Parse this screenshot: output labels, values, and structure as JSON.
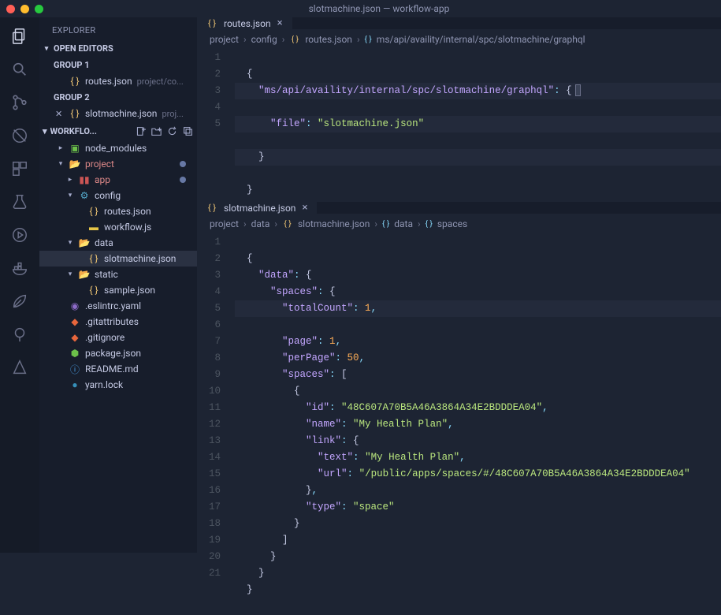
{
  "titlebar": {
    "text": "slotmachine.json — workflow-app"
  },
  "sidebar": {
    "title": "EXPLORER",
    "open_editors": "OPEN EDITORS",
    "group1": "GROUP 1",
    "group2": "GROUP 2",
    "editor1": {
      "name": "routes.json",
      "path": "project/co..."
    },
    "editor2": {
      "name": "slotmachine.json",
      "path": "proj..."
    },
    "workspace_name": "WORKFLO...",
    "tree": {
      "node_modules": "node_modules",
      "project": "project",
      "app": "app",
      "config": "config",
      "routes_json": "routes.json",
      "workflow_js": "workflow.js",
      "data": "data",
      "slotmachine_json": "slotmachine.json",
      "static": "static",
      "sample_json": "sample.json",
      "eslintrc": ".eslintrc.yaml",
      "gitattributes": ".gitattributes",
      "gitignore": ".gitignore",
      "package_json": "package.json",
      "readme": "README.md",
      "yarn_lock": "yarn.lock"
    }
  },
  "pane1": {
    "tab": "routes.json",
    "crumbs": [
      "project",
      "config",
      "routes.json",
      "ms/api/availity/internal/spc/slotmachine/graphql"
    ],
    "line1": "{",
    "line2_key": "\"ms/api/availity/internal/spc/slotmachine/graphql\"",
    "line2_colon": ": ",
    "line2_brace": "{",
    "line3_key": "\"file\"",
    "line3_colon": ": ",
    "line3_val": "\"slotmachine.json\"",
    "line4": "}",
    "line5": "}"
  },
  "pane2": {
    "tab": "slotmachine.json",
    "crumbs": [
      "project",
      "data",
      "slotmachine.json",
      "data",
      "spaces"
    ],
    "lines": {
      "l1": "{",
      "l2_k": "\"data\"",
      "l2_p": ": ",
      "l2_b": "{",
      "l3_k": "\"spaces\"",
      "l3_p": ": ",
      "l3_b": "{",
      "l4_k": "\"totalCount\"",
      "l4_p": ": ",
      "l4_v": "1",
      "l4_c": ",",
      "l5_k": "\"page\"",
      "l5_p": ": ",
      "l5_v": "1",
      "l5_c": ",",
      "l6_k": "\"perPage\"",
      "l6_p": ": ",
      "l6_v": "50",
      "l6_c": ",",
      "l7_k": "\"spaces\"",
      "l7_p": ": ",
      "l7_b": "[",
      "l8": "{",
      "l9_k": "\"id\"",
      "l9_p": ": ",
      "l9_v": "\"48C607A70B5A46A3864A34E2BDDDEA04\"",
      "l9_c": ",",
      "l10_k": "\"name\"",
      "l10_p": ": ",
      "l10_v": "\"My Health Plan\"",
      "l10_c": ",",
      "l11_k": "\"link\"",
      "l11_p": ": ",
      "l11_b": "{",
      "l12_k": "\"text\"",
      "l12_p": ": ",
      "l12_v": "\"My Health Plan\"",
      "l12_c": ",",
      "l13_k": "\"url\"",
      "l13_p": ": ",
      "l13_v": "\"/public/apps/spaces/#/48C607A70B5A46A3864A34E2BDDDEA04\"",
      "l14": "}",
      "l14_c": ",",
      "l15_k": "\"type\"",
      "l15_p": ": ",
      "l15_v": "\"space\"",
      "l16": "}",
      "l17": "]",
      "l18": "}",
      "l19": "}",
      "l20": "}",
      "l21": ""
    }
  },
  "gutters": {
    "p1": [
      "1",
      "2",
      "3",
      "4",
      "5"
    ],
    "p2": [
      "1",
      "2",
      "3",
      "4",
      "5",
      "6",
      "7",
      "8",
      "9",
      "10",
      "11",
      "12",
      "13",
      "14",
      "15",
      "16",
      "17",
      "18",
      "19",
      "20",
      "21"
    ]
  }
}
